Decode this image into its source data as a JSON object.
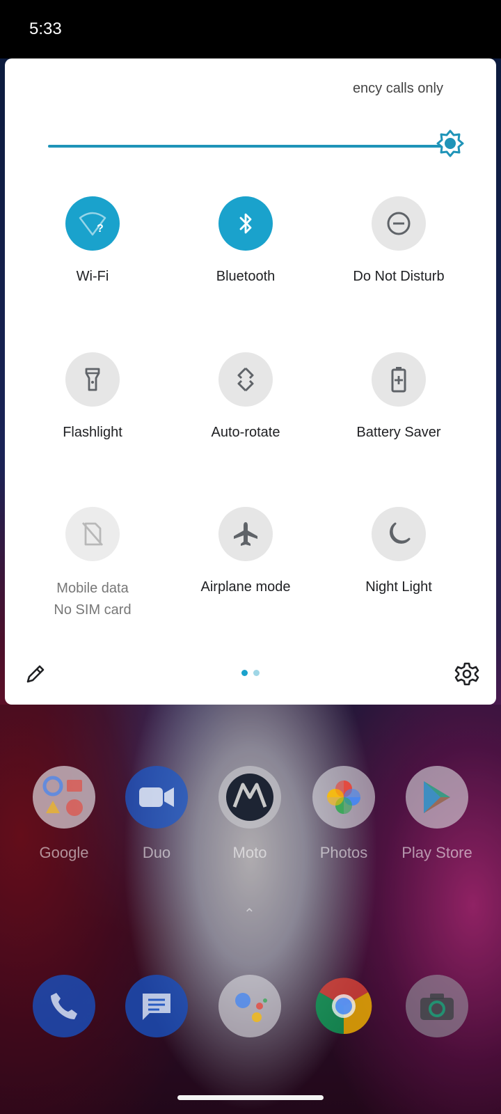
{
  "status_bar": {
    "time": "5:33"
  },
  "quick_settings": {
    "carrier_text": "ency calls only",
    "brightness": {
      "level": 1.0,
      "accent_color": "#1f94b8"
    },
    "tiles": [
      {
        "label": "Wi-Fi",
        "state": "on",
        "icon": "wifi-question-icon"
      },
      {
        "label": "Bluetooth",
        "state": "on",
        "icon": "bluetooth-icon"
      },
      {
        "label": "Do Not Disturb",
        "state": "off",
        "icon": "do-not-disturb-icon"
      },
      {
        "label": "Flashlight",
        "state": "off",
        "icon": "flashlight-icon"
      },
      {
        "label": "Auto-rotate",
        "state": "off",
        "icon": "auto-rotate-icon"
      },
      {
        "label": "Battery Saver",
        "state": "off",
        "icon": "battery-saver-icon"
      },
      {
        "label": "Mobile data",
        "sublabel": "No SIM card",
        "state": "disabled",
        "icon": "no-sim-icon"
      },
      {
        "label": "Airplane mode",
        "state": "off",
        "icon": "airplane-icon"
      },
      {
        "label": "Night Light",
        "state": "off",
        "icon": "night-light-icon"
      }
    ],
    "page_indicator": {
      "pages": 2,
      "current": 1
    }
  },
  "home_screen": {
    "apps": [
      {
        "name": "Google",
        "icon": "google-folder-icon"
      },
      {
        "name": "Duo",
        "icon": "duo-icon"
      },
      {
        "name": "Moto",
        "icon": "moto-icon"
      },
      {
        "name": "Photos",
        "icon": "photos-icon"
      },
      {
        "name": "Play Store",
        "icon": "play-store-icon"
      }
    ],
    "dock": [
      {
        "icon": "phone-icon"
      },
      {
        "icon": "messages-icon"
      },
      {
        "icon": "assistant-icon"
      },
      {
        "icon": "chrome-icon"
      },
      {
        "icon": "camera-icon"
      }
    ]
  }
}
